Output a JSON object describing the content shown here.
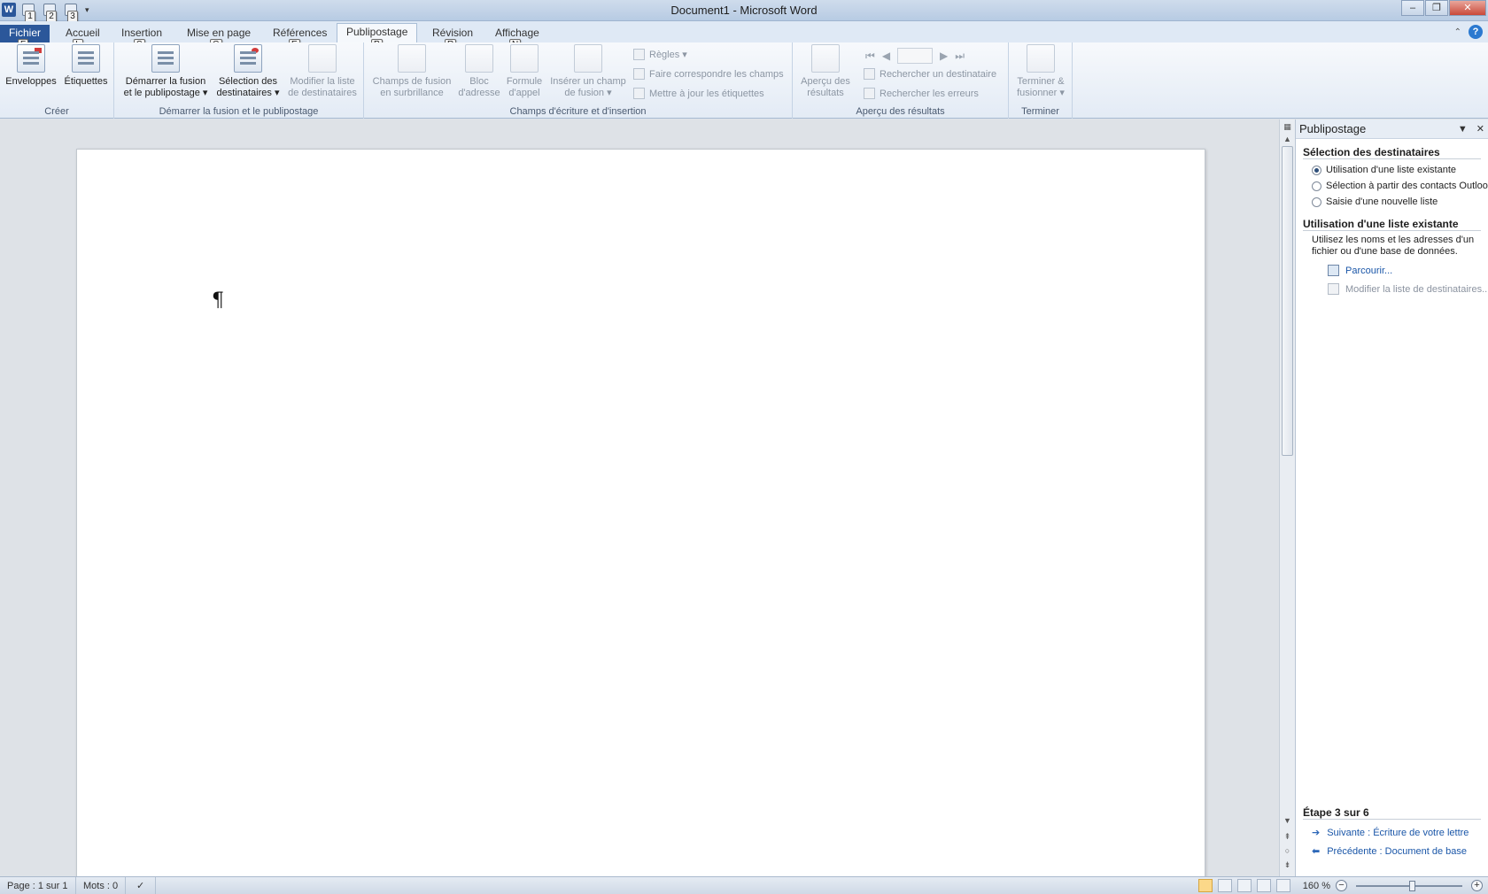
{
  "window": {
    "title": "Document1  -  Microsoft Word",
    "app_icon": "W",
    "controls": {
      "minimize": "–",
      "restore": "❐",
      "close": "✕"
    }
  },
  "qat_keytips": [
    "1",
    "2",
    "3"
  ],
  "tabs": [
    {
      "label": "Fichier",
      "keytip": "F"
    },
    {
      "label": "Accueil",
      "keytip": "L"
    },
    {
      "label": "Insertion",
      "keytip": "S"
    },
    {
      "label": "Mise en page",
      "keytip": "G"
    },
    {
      "label": "Références",
      "keytip": "E"
    },
    {
      "label": "Publipostage",
      "keytip": "P"
    },
    {
      "label": "Révision",
      "keytip": "R"
    },
    {
      "label": "Affichage",
      "keytip": "N"
    }
  ],
  "ribbon": {
    "groups": {
      "creer": "Créer",
      "demarrer": "Démarrer la fusion et le publipostage",
      "champs": "Champs d'écriture et d'insertion",
      "apercu": "Aperçu des résultats",
      "terminer": "Terminer"
    },
    "buttons": {
      "enveloppes": "Enveloppes",
      "etiquettes": "Étiquettes",
      "demarrer_l1": "Démarrer la fusion",
      "demarrer_l2": "et le publipostage ▾",
      "selection_l1": "Sélection des",
      "selection_l2": "destinataires ▾",
      "modifier_l1": "Modifier la liste",
      "modifier_l2": "de destinataires",
      "champs_l1": "Champs de fusion",
      "champs_l2": "en surbrillance",
      "bloc_l1": "Bloc",
      "bloc_l2": "d'adresse",
      "formule_l1": "Formule",
      "formule_l2": "d'appel",
      "inserer_l1": "Insérer un champ",
      "inserer_l2": "de fusion ▾",
      "regles": "Règles ▾",
      "faire_correspondre": "Faire correspondre les champs",
      "mettre_a_jour": "Mettre à jour les étiquettes",
      "apercu_l1": "Aperçu des",
      "apercu_l2": "résultats",
      "rechercher_dest": "Rechercher un destinataire",
      "rechercher_err": "Rechercher les erreurs",
      "terminer_l1": "Terminer &",
      "terminer_l2": "fusionner ▾"
    }
  },
  "document": {
    "pilcrow": "¶"
  },
  "taskpane": {
    "title": "Publipostage",
    "section1": "Sélection des destinataires",
    "radios": [
      {
        "label": "Utilisation d'une liste existante",
        "checked": true
      },
      {
        "label": "Sélection à partir des contacts Outlook",
        "checked": false
      },
      {
        "label": "Saisie d'une nouvelle liste",
        "checked": false
      }
    ],
    "section2": "Utilisation d'une liste existante",
    "description": "Utilisez les noms et les adresses d'un fichier ou d'une base de données.",
    "browse": "Parcourir...",
    "edit_list": "Modifier la liste de destinataires...",
    "step": "Étape 3 sur 6",
    "next": "Suivante : Écriture de votre lettre",
    "previous": "Précédente : Document de base"
  },
  "status": {
    "page": "Page : 1 sur 1",
    "words": "Mots : 0",
    "zoom": "160 %"
  }
}
